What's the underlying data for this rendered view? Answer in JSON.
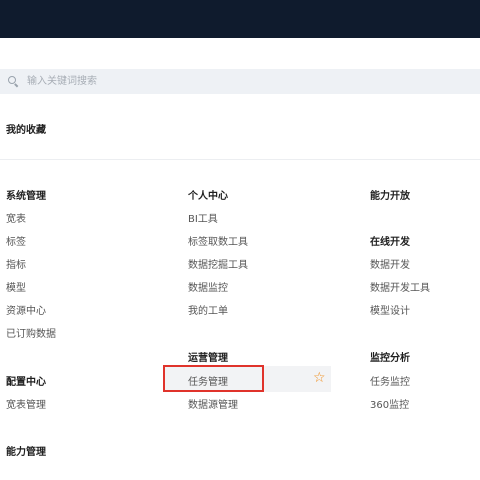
{
  "search": {
    "placeholder": "输入关键词搜索",
    "value": ""
  },
  "favorites": {
    "title": "我的收藏"
  },
  "groups": {
    "system_mgmt": {
      "title": "系统管理",
      "items": [
        "宽表",
        "标签",
        "指标",
        "模型",
        "资源中心",
        "已订购数据"
      ]
    },
    "config_center": {
      "title": "配置中心",
      "items": [
        "宽表管理"
      ]
    },
    "capability_mgmt": {
      "title": "能力管理"
    },
    "personal_center": {
      "title": "个人中心",
      "items": [
        "BI工具",
        "标签取数工具",
        "数据挖掘工具",
        "数据监控",
        "我的工单"
      ]
    },
    "ops_mgmt": {
      "title": "运营管理",
      "items": [
        "任务管理",
        "数据源管理"
      ]
    },
    "capability_open": {
      "title": "能力开放"
    },
    "online_dev": {
      "title": "在线开发",
      "items": [
        "数据开发",
        "数据开发工具",
        "模型设计"
      ]
    },
    "monitor_analysis": {
      "title": "监控分析",
      "items": [
        "任务监控",
        "360监控"
      ]
    }
  },
  "icons": {
    "search": "search-icon",
    "favorite": "star-outline-icon"
  },
  "colors": {
    "topbar": "#0f1b2d",
    "highlight": "#e0332b",
    "star": "#f08c1a"
  }
}
